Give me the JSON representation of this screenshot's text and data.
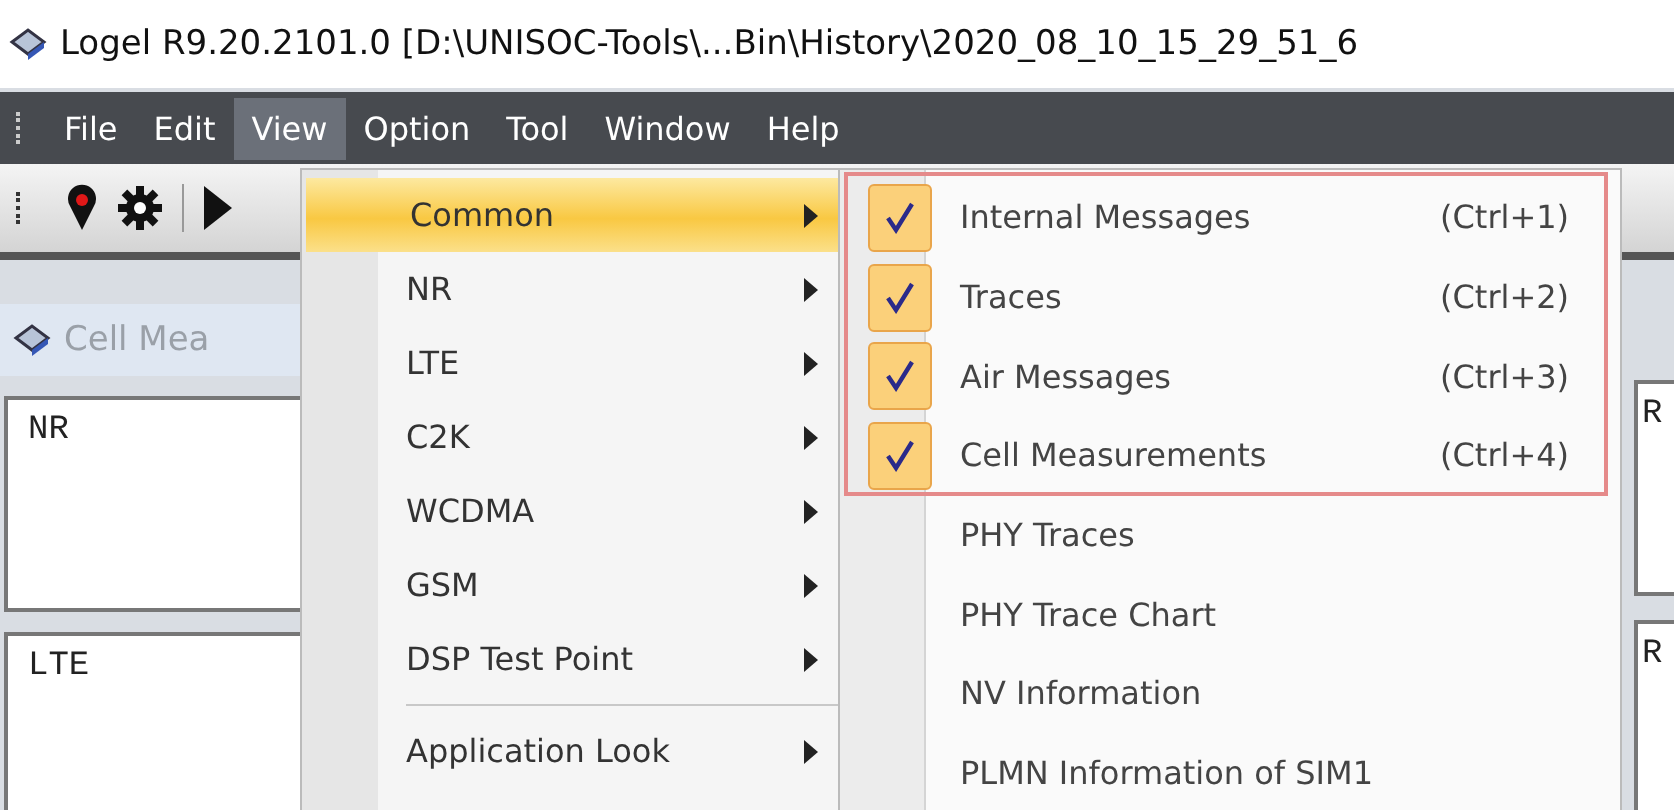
{
  "window": {
    "title": "Logel R9.20.2101.0 [D:\\UNISOC-Tools\\...Bin\\History\\2020_08_10_15_29_51_6"
  },
  "menu_bar": [
    {
      "label": "File",
      "selected": false
    },
    {
      "label": "Edit",
      "selected": false
    },
    {
      "label": "View",
      "selected": true
    },
    {
      "label": "Option",
      "selected": false
    },
    {
      "label": "Tool",
      "selected": false
    },
    {
      "label": "Window",
      "selected": false
    },
    {
      "label": "Help",
      "selected": false
    }
  ],
  "panel": {
    "tab": "Cell Mea",
    "sections": [
      {
        "label": "NR"
      },
      {
        "label": "LTE"
      }
    ],
    "right_sections": [
      {
        "label": "R"
      },
      {
        "label": "R"
      }
    ]
  },
  "view_menu": [
    {
      "kind": "submenu",
      "label": "Common",
      "selected": true
    },
    {
      "kind": "submenu",
      "label": "NR",
      "selected": false
    },
    {
      "kind": "submenu",
      "label": "LTE",
      "selected": false
    },
    {
      "kind": "submenu",
      "label": "C2K",
      "selected": false
    },
    {
      "kind": "submenu",
      "label": "WCDMA",
      "selected": false
    },
    {
      "kind": "submenu",
      "label": "GSM",
      "selected": false
    },
    {
      "kind": "submenu",
      "label": "DSP Test Point",
      "selected": false
    },
    {
      "kind": "separator"
    },
    {
      "kind": "submenu",
      "label": "Application Look",
      "selected": false
    }
  ],
  "common_submenu": [
    {
      "label": "Internal Messages",
      "shortcut": "(Ctrl+1)",
      "checked": true
    },
    {
      "label": "Traces",
      "shortcut": "(Ctrl+2)",
      "checked": true
    },
    {
      "label": "Air Messages",
      "shortcut": "(Ctrl+3)",
      "checked": true
    },
    {
      "label": "Cell Measurements",
      "shortcut": "(Ctrl+4)",
      "checked": true
    },
    {
      "label": "PHY Traces",
      "checked": false
    },
    {
      "label": "PHY Trace Chart",
      "checked": false
    },
    {
      "label": "NV Information",
      "checked": false
    },
    {
      "label": "PLMN Information of SIM1",
      "checked": false
    }
  ]
}
